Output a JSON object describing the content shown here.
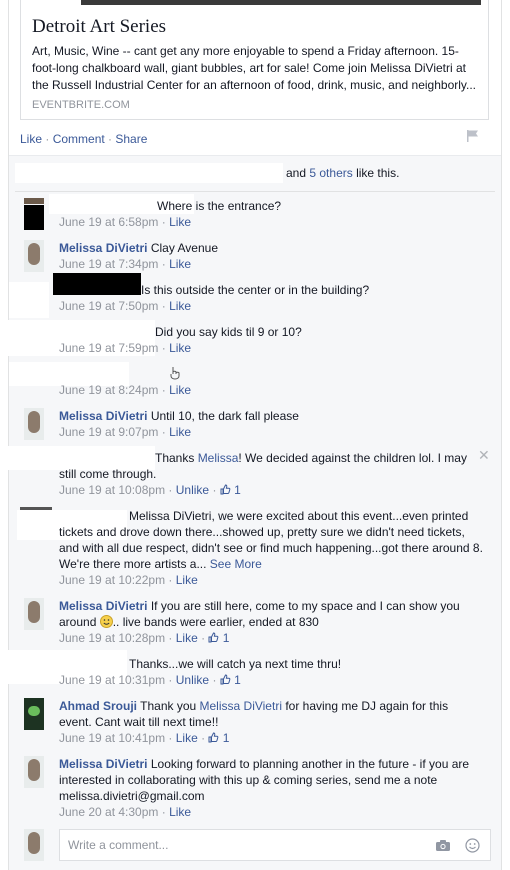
{
  "post": {
    "preview": {
      "title": "Detroit Art Series",
      "description": "Art, Music, Wine -- cant get any more enjoyable to spend a Friday afternoon. 15-foot-long chalkboard wall, giant bubbles, art for sale! Come join Melissa DiVietri at the Russell Industrial Center for an afternoon of food, drink, music, and neighborly...",
      "source": "EVENTBRITE.COM"
    },
    "actions": {
      "like": "Like",
      "comment": "Comment",
      "share": "Share",
      "sep": " · "
    }
  },
  "likes": {
    "prefix": "and",
    "others": "5 others",
    "suffix": "like this."
  },
  "comments": [
    {
      "author": "",
      "text": "Where is the entrance?",
      "time": "June 19 at 6:58pm",
      "action": "Like",
      "count": ""
    },
    {
      "author": "Melissa DiVietri",
      "text": "Clay Avenue",
      "time": "June 19 at 7:34pm",
      "action": "Like",
      "count": ""
    },
    {
      "author": "",
      "text": "Is this outside the center or in the building?",
      "time": "June 19 at 7:50pm",
      "action": "Like",
      "count": ""
    },
    {
      "author": "",
      "text": "Did you say kids til 9 or 10?",
      "time": "June 19 at 7:59pm",
      "action": "Like",
      "count": ""
    },
    {
      "author": "",
      "text": "",
      "time": "June 19 at 8:24pm",
      "action": "Like",
      "count": ""
    },
    {
      "author": "Melissa DiVietri",
      "text": "Until 10, the dark fall please",
      "time": "June 19 at 9:07pm",
      "action": "Like",
      "count": ""
    },
    {
      "author": "",
      "text_pre": "Thanks ",
      "mention": "Melissa",
      "text_post": "! We decided against the children lol. I may still come through.",
      "time": "June 19 at 10:08pm",
      "action": "Unlike",
      "count": "1"
    },
    {
      "author": "",
      "text": "Melissa DiVietri, we were excited about this event...even printed tickets and drove down there...showed up, pretty sure we didn't need tickets, and with all due respect, didn't see or find much happening...got there around 8. We're there more artists a...",
      "see_more": "See More",
      "time": "June 19 at 10:22pm",
      "action": "Like",
      "count": ""
    },
    {
      "author": "Melissa DiVietri",
      "text": "If you are still here, come to my space and I can show you around",
      "text_post": ".. live bands were earlier, ended at 830",
      "time": "June 19 at 10:28pm",
      "action": "Like",
      "count": "1"
    },
    {
      "author": "",
      "text": "Thanks...we will catch ya next time thru!",
      "time": "June 19 at 10:31pm",
      "action": "Unlike",
      "count": "1"
    },
    {
      "author": "Ahmad Srouji",
      "text_pre": "Thank you ",
      "mention": "Melissa DiVietri",
      "text_post": " for having me DJ again for this event. Cant wait till next time!!",
      "time": "June 19 at 10:41pm",
      "action": "Like",
      "count": "1"
    },
    {
      "author": "Melissa DiVietri",
      "text": "Looking forward to planning another in the future - if you are interested in collaborating with this up & coming series, send me a note melissa.divietri@gmail.com",
      "time": "June 20 at 4:30pm",
      "action": "Like",
      "count": ""
    }
  ],
  "composer": {
    "placeholder": "Write a comment..."
  },
  "icons": [
    "flag-icon",
    "like-thumb-icon",
    "camera-icon",
    "emoji-icon",
    "close-icon",
    "hand-cursor-icon"
  ],
  "colors": {
    "link": "#3b5998",
    "meta": "#90949c",
    "background": "#f6f7f9"
  }
}
